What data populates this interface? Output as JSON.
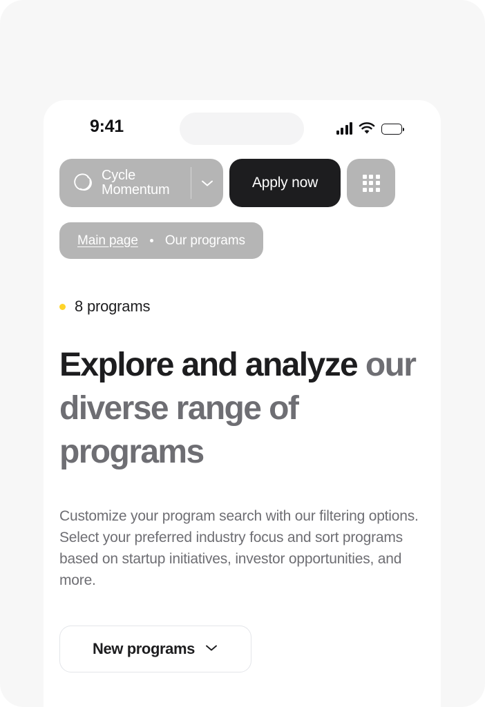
{
  "status_bar": {
    "time": "9:41",
    "signal_icon": "cellular-signal-icon",
    "wifi_icon": "wifi-icon",
    "battery_icon": "battery-full-icon"
  },
  "nav": {
    "brand": {
      "logo_icon": "cycle-logo-icon",
      "name": "Cycle\nMomentum",
      "caret_icon": "chevron-down-icon"
    },
    "apply_label": "Apply now",
    "grid_icon": "grid-menu-icon"
  },
  "breadcrumb": {
    "home_label": "Main page",
    "separator": "•",
    "current_label": "Our programs"
  },
  "main": {
    "count_label": "8 programs",
    "count_dot_color": "#ffd429",
    "headline_strong": "Explore and analyze",
    "headline_rest": "our diverse range of programs",
    "paragraph": "Customize your program search with our filtering options. Select your preferred industry focus and sort programs based on startup initiatives, investor opportunities, and more.",
    "filter_label": "New programs",
    "filter_caret_icon": "chevron-down-icon"
  }
}
